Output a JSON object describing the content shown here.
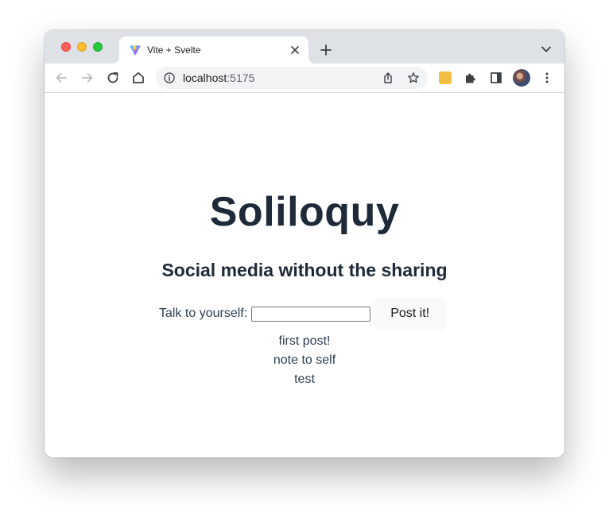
{
  "browser": {
    "tab": {
      "title": "Vite + Svelte",
      "favicon": "vite-logo-icon"
    },
    "address_bar": {
      "host": "localhost",
      "port": ":5175"
    },
    "colors": {
      "tab_strip": "#dee1e6",
      "traffic_red": "#fe5f57",
      "traffic_yellow": "#febc2e",
      "traffic_green": "#28c840"
    }
  },
  "page": {
    "title": "Soliloquy",
    "subtitle": "Social media without the sharing",
    "form": {
      "label": "Talk to yourself:",
      "input_value": "",
      "button_label": "Post it!"
    },
    "posts": [
      "first post!",
      "note to self",
      "test"
    ],
    "colors": {
      "heading": "#1e2a38",
      "text": "#2c3e50",
      "button_bg": "#f9f9f9"
    }
  }
}
